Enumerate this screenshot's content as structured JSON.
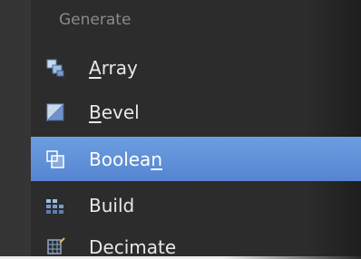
{
  "menu": {
    "header": "Generate",
    "items": [
      {
        "pre": "",
        "mn": "A",
        "post": "rray",
        "icon": "array-modifier-icon",
        "selected": false
      },
      {
        "pre": "",
        "mn": "B",
        "post": "evel",
        "icon": "bevel-modifier-icon",
        "selected": false
      },
      {
        "pre": "Boolea",
        "mn": "n",
        "post": "",
        "icon": "boolean-modifier-icon",
        "selected": true
      },
      {
        "pre": "Build",
        "mn": "",
        "post": "",
        "icon": "build-modifier-icon",
        "selected": false
      },
      {
        "pre": "Decimate",
        "mn": "",
        "post": "",
        "icon": "decimate-modifier-icon",
        "selected": false
      }
    ]
  },
  "colors": {
    "background": "#2c2c2c",
    "highlight": "#5a8bd6",
    "text": "#e8e8e8",
    "header_text": "#8a8a8a"
  }
}
